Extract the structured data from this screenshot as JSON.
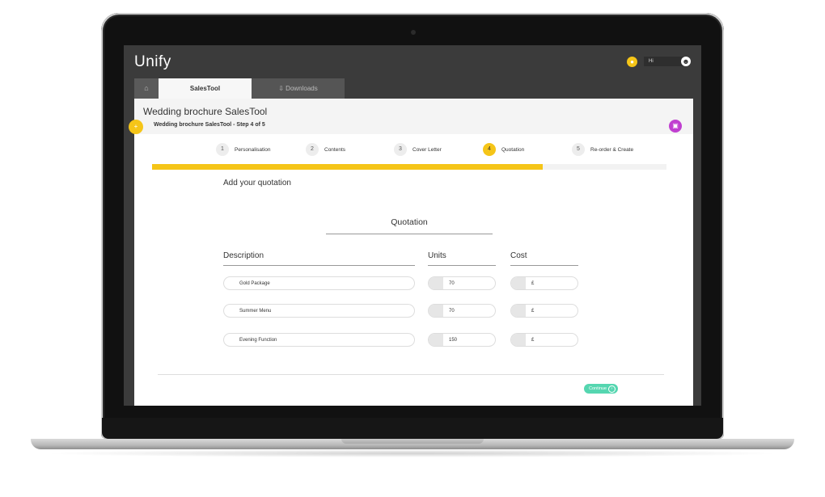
{
  "header": {
    "app_name": "Unify",
    "greeting": "Hi"
  },
  "tabs": [
    {
      "label": ""
    },
    {
      "label": "SalesTool"
    },
    {
      "label": "Downloads"
    }
  ],
  "page": {
    "title": "Wedding brochure SalesTool",
    "step_title": "Wedding brochure SalesTool - Step 4 of 5"
  },
  "steps": [
    {
      "num": "1",
      "label": "Personalisation"
    },
    {
      "num": "2",
      "label": "Contents"
    },
    {
      "num": "3",
      "label": "Cover Letter"
    },
    {
      "num": "4",
      "label": "Quotation"
    },
    {
      "num": "5",
      "label": "Re-order & Create"
    }
  ],
  "progress": {
    "fraction": 0.76
  },
  "quotation": {
    "heading": "Add your quotation",
    "section_title": "Quotation",
    "columns": {
      "description": "Description",
      "units": "Units",
      "cost": "Cost"
    },
    "rows": [
      {
        "description": "Gold Package",
        "units": "70",
        "cost": "£"
      },
      {
        "description": "Summer Menu",
        "units": "70",
        "cost": "£"
      },
      {
        "description": "Evening Function",
        "units": "150",
        "cost": "£"
      }
    ]
  },
  "actions": {
    "continue_label": "Continue"
  },
  "colors": {
    "accent": "#f5c518",
    "continue": "#55d6b0",
    "robot": "#c03fd0"
  },
  "icons": [
    "home-icon",
    "download-icon",
    "bell-icon",
    "user-icon",
    "plus-icon",
    "robot-icon",
    "arrow-right-icon"
  ]
}
